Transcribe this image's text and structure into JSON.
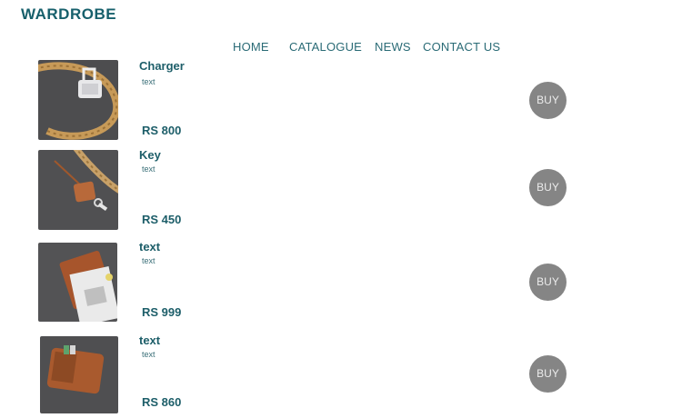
{
  "brand": "WARDROBE",
  "nav": {
    "home": "HOME",
    "catalogue": "CATALOGUE",
    "news": "NEWS",
    "contact": "CONTACT US"
  },
  "products": [
    {
      "title": "Charger",
      "description": "text",
      "price": "RS 800",
      "button": "BUY",
      "image": "charger-on-rope"
    },
    {
      "title": "Key",
      "description": "text",
      "price": "RS 450",
      "button": "BUY",
      "image": "leather-key-tag"
    },
    {
      "title": "text",
      "description": "text",
      "price": "RS 999",
      "button": "BUY",
      "image": "leather-notebook-with-magazine"
    },
    {
      "title": "text",
      "description": "text",
      "price": "RS 860",
      "button": "BUY",
      "image": "leather-wallet"
    }
  ]
}
